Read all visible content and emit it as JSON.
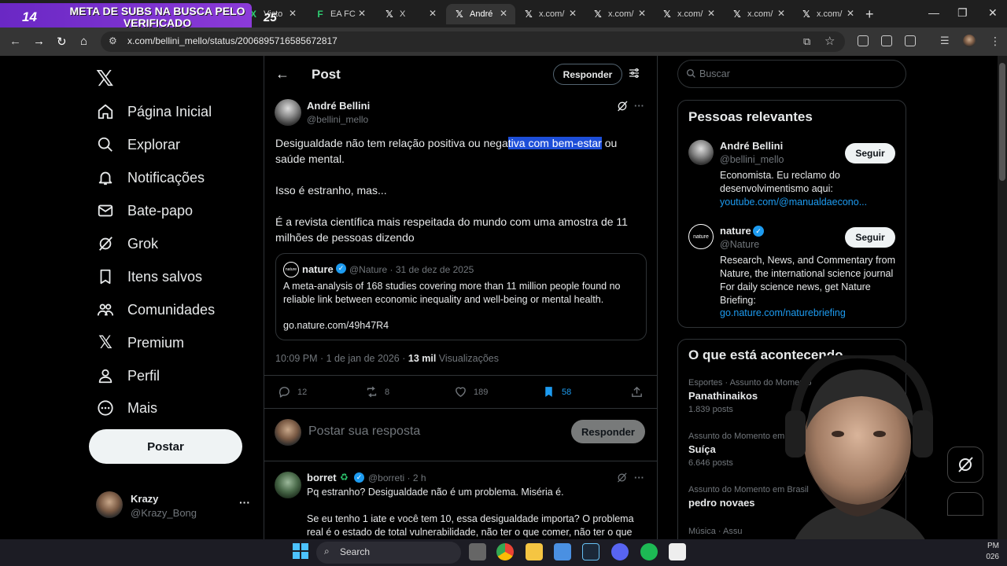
{
  "overlay": {
    "count": "14",
    "goal_line1": "META DE SUBS NA BUSCA PELO",
    "goal_line2": "VERIFICADO",
    "target": "25"
  },
  "browser": {
    "tabs": [
      {
        "label": "Victo",
        "icon": "x-green-icon"
      },
      {
        "label": "EA FC",
        "icon": "ea-fc-icon"
      },
      {
        "label": "X",
        "icon": "x-icon"
      },
      {
        "label": "André",
        "icon": "x-icon",
        "active": true
      },
      {
        "label": "x.com/",
        "icon": "x-icon"
      },
      {
        "label": "x.com/",
        "icon": "x-icon"
      },
      {
        "label": "x.com/",
        "icon": "x-icon"
      },
      {
        "label": "x.com/",
        "icon": "x-icon"
      },
      {
        "label": "x.com/",
        "icon": "x-icon"
      }
    ],
    "url": "x.com/bellini_mello/status/2006895716585672817"
  },
  "sidebar": {
    "items": [
      {
        "label": "Página Inicial",
        "icon": "home-icon"
      },
      {
        "label": "Explorar",
        "icon": "search-icon"
      },
      {
        "label": "Notificações",
        "icon": "bell-icon"
      },
      {
        "label": "Bate-papo",
        "icon": "mail-icon"
      },
      {
        "label": "Grok",
        "icon": "grok-icon"
      },
      {
        "label": "Itens salvos",
        "icon": "bookmark-icon"
      },
      {
        "label": "Comunidades",
        "icon": "communities-icon"
      },
      {
        "label": "Premium",
        "icon": "x-icon"
      },
      {
        "label": "Perfil",
        "icon": "person-icon"
      },
      {
        "label": "Mais",
        "icon": "more-circle-icon"
      }
    ],
    "post_label": "Postar",
    "account": {
      "name": "Krazy",
      "handle": "@Krazy_Bong"
    }
  },
  "header": {
    "title": "Post",
    "reply_label": "Responder"
  },
  "tweet": {
    "author_name": "André Bellini",
    "author_handle": "@bellini_mello",
    "text_before": "Desigualdade não tem relação positiva ou nega",
    "text_highlight": "tiva com bem-estar",
    "text_after": " ou saúde mental.\n\nIsso é estranho, mas...\n\nÉ a revista científica mais respeitada do mundo com uma amostra de 11 milhões de pessoas dizendo",
    "quote": {
      "name": "nature",
      "meta": "@Nature · 31 de dez de 2025",
      "text": "A meta-analysis of 168 studies covering more than 11 million people found no reliable link between economic inequality and well-being or mental health.",
      "link": "go.nature.com/49h47R4"
    },
    "time": "10:09 PM · 1 de jan de 2026 · ",
    "views_count": "13 mil",
    "views_label": " Visualizações",
    "stats": {
      "replies": "12",
      "retweets": "8",
      "likes": "189",
      "bookmarks": "58"
    }
  },
  "compose": {
    "placeholder": "Postar sua resposta",
    "button": "Responder"
  },
  "reply": {
    "name": "borret",
    "handle": "@borreti · 2 h",
    "text": "Pq estranho? Desigualdade não é um problema. Miséria é.\n\nSe eu tenho 1 iate e você tem 10, essa desigualdade importa?  O problema real é o estado de total vulnerabilidade, não ter o que comer, não ter o que"
  },
  "right": {
    "search_placeholder": "Buscar",
    "relevant_title": "Pessoas relevantes",
    "people": [
      {
        "name": "André Bellini",
        "handle": "@bellini_mello",
        "bio": "Economista. Eu reclamo do desenvolvimentismo aqui:",
        "link": "youtube.com/@manualdaecono...",
        "follow": "Seguir"
      },
      {
        "name": "nature",
        "handle": "@Nature",
        "bio": "Research, News, and Commentary from Nature, the international science journal For daily science news, get Nature Briefing:",
        "link": "go.nature.com/naturebriefing",
        "follow": "Seguir"
      }
    ],
    "trending_title": "O que está acontecendo",
    "trends": [
      {
        "category": "Esportes · Assunto do Momento",
        "title": "Panathinaikos",
        "count": "1.839 posts"
      },
      {
        "category": "Assunto do Momento em Br",
        "title": "Suíça",
        "count": "6.646 posts"
      },
      {
        "category": "Assunto do Momento em Brasil",
        "title": "pedro novaes",
        "count": ""
      },
      {
        "category": "Música · Assu",
        "title": "",
        "count": ""
      }
    ]
  },
  "taskbar": {
    "search_label": "Search",
    "time": "PM",
    "date": "026"
  },
  "colors": {
    "accent": "#1d9bf0",
    "overlay": "#7b32d0",
    "highlight": "#1d4ed8"
  }
}
